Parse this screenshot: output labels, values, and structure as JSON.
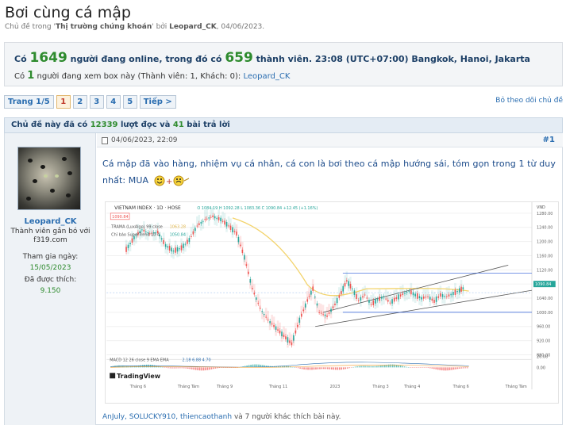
{
  "thread": {
    "title": "Bơi cùng cá mập",
    "meta_prefix": "Chủ đề trong '",
    "forum": "Thị trường chứng khoán",
    "meta_mid": "' bởi ",
    "author": "Leopard_CK",
    "meta_date": ", 04/06/2023."
  },
  "online": {
    "prefix": "Có ",
    "total": "1649",
    "mid": " người đang online, trong đó có ",
    "members": "659",
    "suffix": " thành viên. 23:08 (UTC+07:00) Bangkok, Hanoi, Jakarta",
    "viewing_prefix": "Có ",
    "viewing_count": "1",
    "viewing_suffix": " người đang xem box này (Thành viên: 1, Khách: 0): ",
    "viewer": "Leopard_CK"
  },
  "pagination": {
    "page_label": "Trang 1/5",
    "pages": [
      "1",
      "2",
      "3",
      "4",
      "5"
    ],
    "next": "Tiếp >",
    "follow": "Bỏ theo dõi chủ đề"
  },
  "stats": {
    "prefix": "Chủ đề này đã có ",
    "views": "12339",
    "mid": " lượt đọc và ",
    "replies": "41",
    "suffix": " bài trả lời"
  },
  "post": {
    "date": "04/06/2023, 22:09",
    "number": "#1",
    "text_line1": "Cá mập đã vào hàng, nhiệm vụ cá nhân, cá con là bơi theo cá mập hướng sái, tóm gọn trong 1 từ duy",
    "text_line2": "nhất: MUA",
    "likes_names": "AnJuly, SOLUCKY910, thiencaothanh",
    "likes_rest": " và 7 người khác thích bài này."
  },
  "user": {
    "name": "Leopard_CK",
    "title": "Thành viên gắn bó với f319.com",
    "join_label": "Tham gia ngày:",
    "join_date": "15/05/2023",
    "likes_label": "Đã được thích:",
    "likes_value": "9.150"
  },
  "chart_labels": {
    "header": "VIETNAM INDEX · 1D · HOSE",
    "ohlc": "O 1084.19  H 1092.28  L 1083.36  C 1090.84  +12.45 (+1.16%)",
    "price_tag": "1090.84",
    "trama": "TRAMA (LuxAlgo) 99 close",
    "trama_val": "1063.28",
    "supertrend": "Chỉ báo SuperTrend 10 4",
    "supertrend_val": "1050.84",
    "currency": "VND",
    "macd": "MACD 12 26 close 9 EMA EMA",
    "macd_vals": "2.18  6.88  4.70",
    "brand": "TradingView",
    "y_ticks": [
      "1280.00",
      "1240.00",
      "1200.00",
      "1160.00",
      "1120.00",
      "1080.00",
      "1040.00",
      "1000.00",
      "960.00",
      "920.00",
      "880.00"
    ],
    "x_ticks": [
      "Tháng 6",
      "Tháng Tám",
      "Tháng 9",
      "Tháng 11",
      "2023",
      "Tháng 3",
      "Tháng 4",
      "Tháng 6",
      "Tháng Tám"
    ],
    "macd_ticks": [
      "20.00",
      "0.00"
    ],
    "last_price": "1090.84"
  },
  "colors": {
    "link": "#2a6db0",
    "green": "#2e8b2e",
    "up_candle": "#26a69a",
    "down_candle": "#ef5350"
  }
}
